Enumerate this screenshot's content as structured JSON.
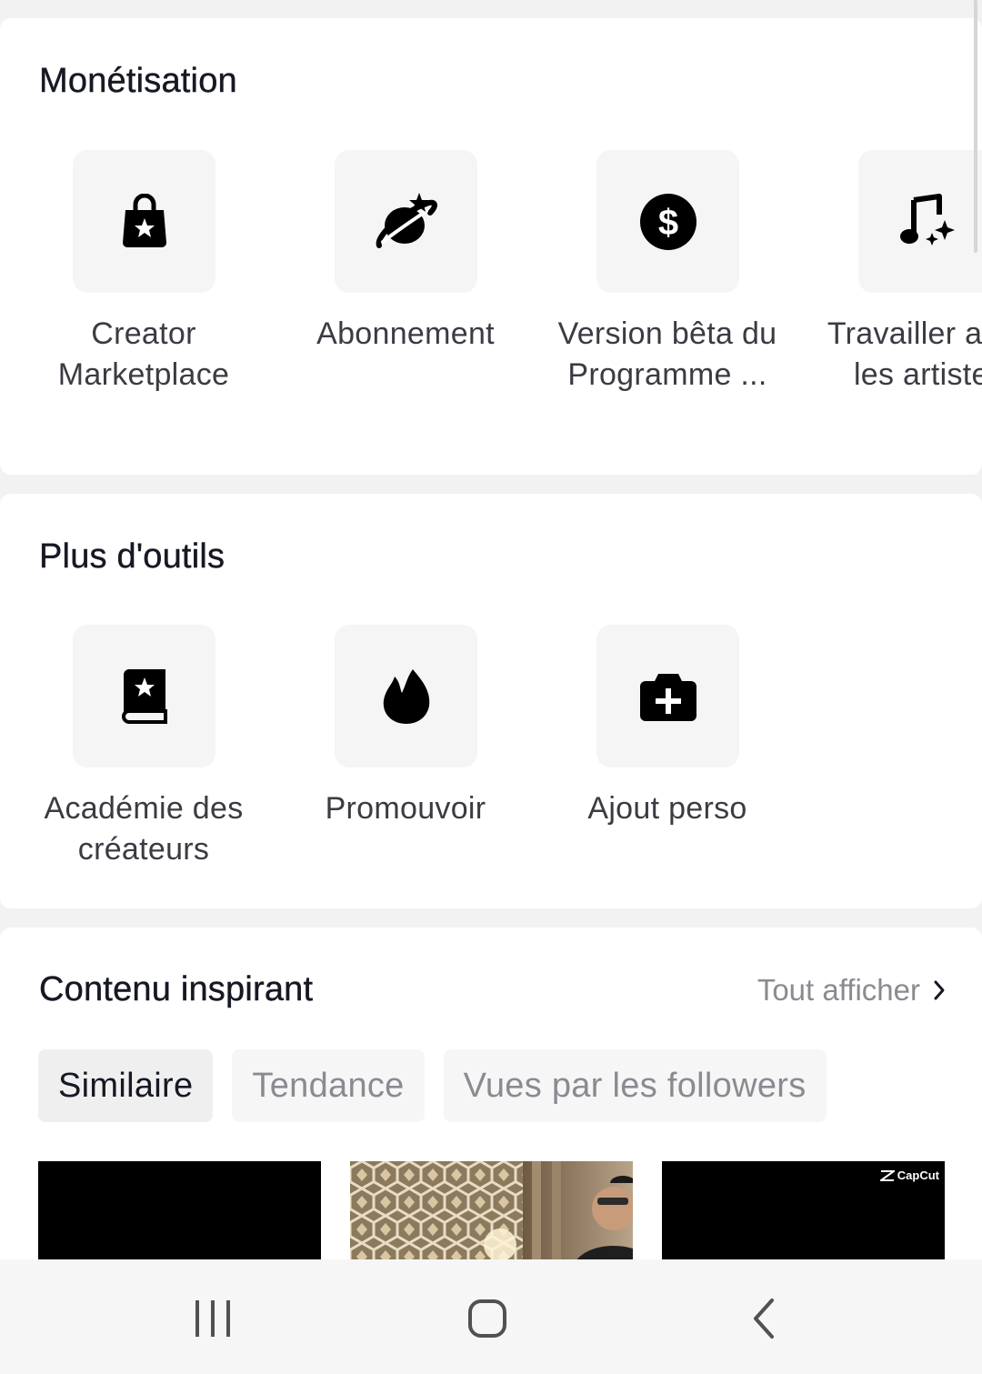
{
  "monetisation": {
    "title": "Monétisation",
    "items": [
      {
        "label": "Creator Marketplace",
        "icon": "shopping-bag-star-icon"
      },
      {
        "label": "Abonnement",
        "icon": "planet-star-icon"
      },
      {
        "label": "Version bêta du Programme ...",
        "icon": "dollar-coin-icon"
      },
      {
        "label": "Travailler avec les artistes",
        "icon": "music-note-sparkle-icon"
      }
    ]
  },
  "tools": {
    "title": "Plus d'outils",
    "items": [
      {
        "label": "Académie des créateurs",
        "icon": "book-star-icon"
      },
      {
        "label": "Promouvoir",
        "icon": "flame-icon"
      },
      {
        "label": "Ajout perso",
        "icon": "camera-plus-icon"
      }
    ]
  },
  "inspiring": {
    "title": "Contenu inspirant",
    "see_all": "Tout afficher",
    "tabs": [
      "Similaire",
      "Tendance",
      "Vues par les followers"
    ],
    "active_tab": "Similaire",
    "thumb_brand": "CapCut"
  },
  "colors": {
    "text": "#161823",
    "secondary_text": "#8a8b91",
    "tile_background": "#f5f5f5",
    "page_background": "#f2f2f2"
  }
}
